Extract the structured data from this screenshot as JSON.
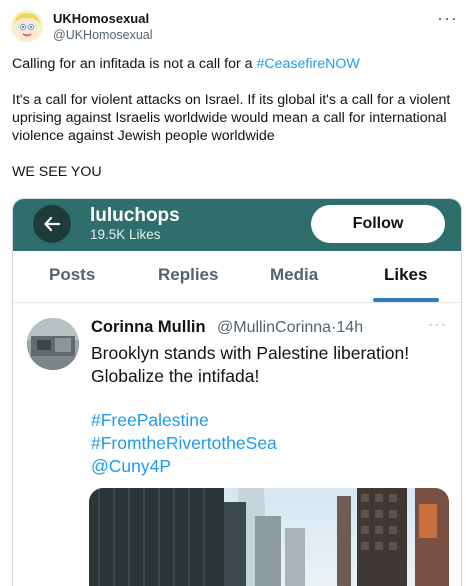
{
  "tweet": {
    "author_name": "UKHomosexual",
    "author_handle": "@UKHomosexual",
    "more_icon": "more-horizontal-icon",
    "text_line1_prefix": "Calling for an infitada is not a call for a ",
    "text_line1_hashtag": "#CeasefireNOW",
    "text_para2": "It's a call for violent attacks on Israel. If its global it's a call for a violent uprising against Israelis worldwide would mean a call for international violence against Jewish people worldwide",
    "text_para3": "WE SEE YOU"
  },
  "embed": {
    "header": {
      "back_icon": "back-arrow-icon",
      "profile_name": "luluchops",
      "likes_count": "19.5K Likes",
      "follow_label": "Follow",
      "background_color": "#2e6f6d"
    },
    "tabs": [
      "Posts",
      "Replies",
      "Media",
      "Likes"
    ],
    "active_tab": "Likes",
    "post": {
      "author_name": "Corinna Mullin",
      "author_handle": "@MullinCorinna",
      "separator": "·",
      "time": "14h",
      "text": "Brooklyn stands with Palestine liberation! Globalize the intifada!",
      "tags": [
        "#FreePalestine",
        "#FromtheRivertotheSea",
        "@Cuny4P"
      ]
    }
  },
  "colors": {
    "link": "#1d9bf0",
    "text": "#0f1419",
    "muted": "#536471"
  }
}
